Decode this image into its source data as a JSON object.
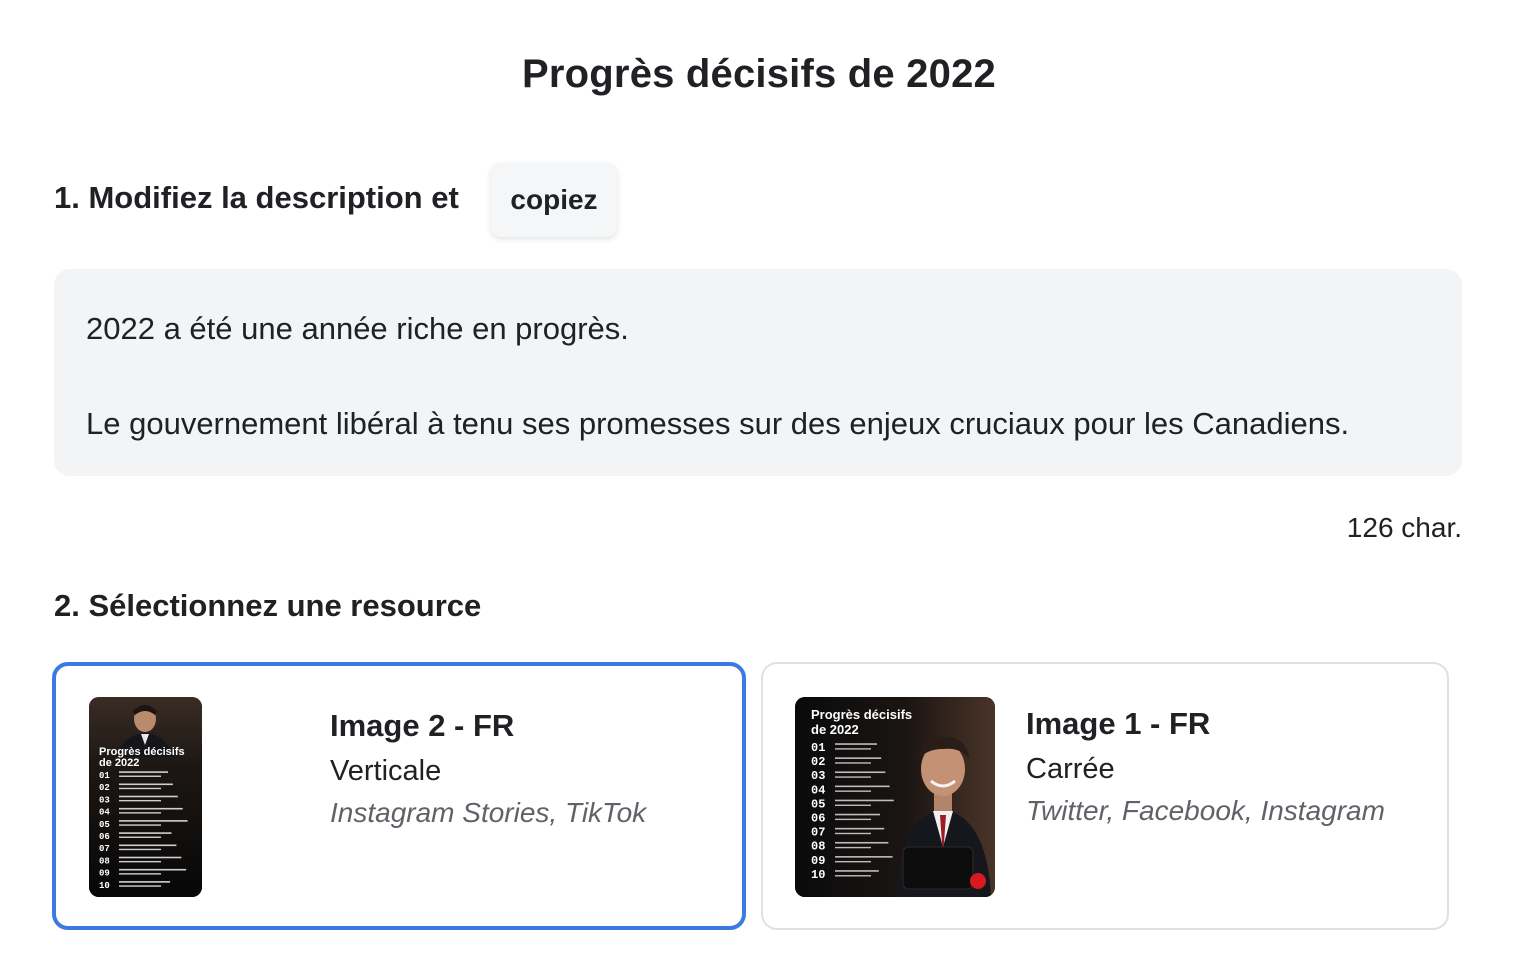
{
  "page": {
    "title": "Progrès décisifs de 2022"
  },
  "step1": {
    "label": "1. Modifiez la description et",
    "copy_button": "copiez"
  },
  "description": {
    "line1": "2022 a été une année riche en progrès.",
    "line2": "Le gouvernement libéral à tenu ses promesses sur des enjeux cruciaux pour les Canadiens."
  },
  "char_count": "126 char.",
  "step2": {
    "label": "2. Sélectionnez une resource"
  },
  "resources": [
    {
      "title": "Image 2 - FR",
      "format": "Verticale",
      "platforms": "Instagram Stories, TikTok",
      "selected": true,
      "thumb": {
        "heading_line1": "Progrès décisifs",
        "heading_line2": "de 2022",
        "numbers": [
          "01",
          "02",
          "03",
          "04",
          "05",
          "06",
          "07",
          "08",
          "09",
          "10"
        ]
      }
    },
    {
      "title": "Image 1 - FR",
      "format": "Carrée",
      "platforms": "Twitter, Facebook, Instagram",
      "selected": false,
      "thumb": {
        "heading_line1": "Progrès décisifs",
        "heading_line2": "de 2022",
        "numbers": [
          "01",
          "02",
          "03",
          "04",
          "05",
          "06",
          "07",
          "08",
          "09",
          "10"
        ]
      }
    }
  ],
  "colors": {
    "selected_border": "#3b7ae0",
    "card_border": "#dfe1e5",
    "desc_background": "#f3f4f6",
    "logo_red": "#d71920"
  }
}
